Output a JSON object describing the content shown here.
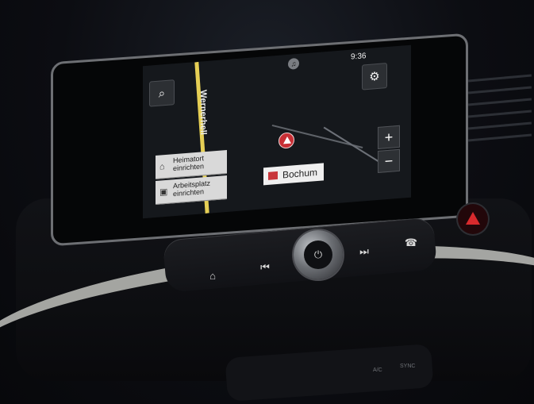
{
  "screen": {
    "time": "9:36",
    "street_name": "Wernerhell",
    "city_label": "Bochum",
    "home_card": {
      "line1": "Heimatort",
      "line2": "einrichten"
    },
    "work_card": {
      "line1": "Arbeitsplatz",
      "line2": "einrichten"
    }
  },
  "icons": {
    "search": "search-icon",
    "settings": "gear-icon",
    "media": "music-icon",
    "zoom_in": "plus-icon",
    "zoom_out": "minus-icon",
    "home": "home-icon",
    "work": "briefcase-icon",
    "navigation_pin": "location-arrow-icon",
    "flag": "flag-icon",
    "home_hardware": "home-icon",
    "previous_track": "previous-track-icon",
    "power": "power-icon",
    "next_track": "next-track-icon",
    "phone": "phone-icon",
    "hazard": "hazard-icon"
  },
  "lower_panel_text": {
    "ac": "A/C",
    "sync": "SYNC"
  },
  "colors": {
    "road": "#e6cf55",
    "pin": "#c72f35",
    "hazard": "#d82a2d"
  }
}
